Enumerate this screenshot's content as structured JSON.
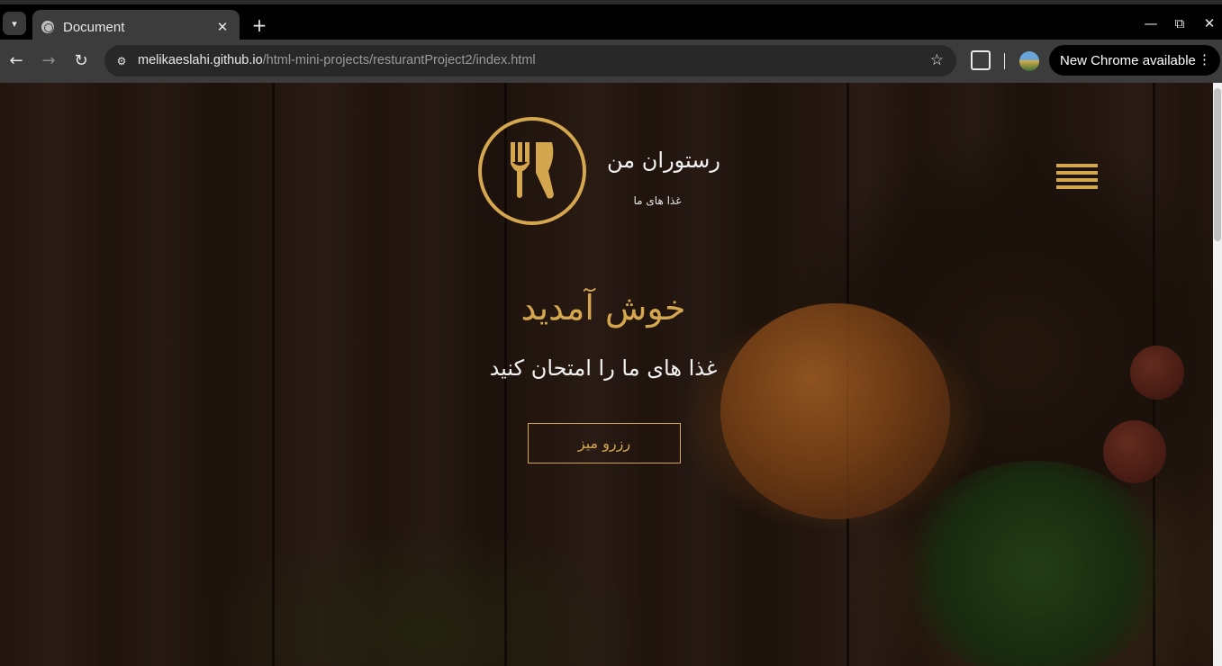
{
  "browser": {
    "tab_title": "Document",
    "tab_close": "✕",
    "new_tab": "+",
    "url_host": "melikaeslahi.github.io",
    "url_path": "/html-mini-projects/resturantProject2/index.html",
    "update_label": "New Chrome available",
    "icons": {
      "tab_search": "chevron-down-icon",
      "back": "arrow-left-icon",
      "forward": "arrow-right-icon",
      "reload": "reload-icon",
      "site_info": "tune-icon",
      "bookmark": "star-icon",
      "extensions": "puzzle-icon",
      "minimize": "minimize-icon",
      "restore": "restore-icon",
      "close": "close-icon"
    }
  },
  "site": {
    "brand_name": "رستوران من",
    "brand_tagline": "غذا های ما",
    "hero_title": "خوش آمدید",
    "hero_subtitle": "غذا های ما را امتحان کنید",
    "reserve_button": "رزرو میز",
    "accent_color": "#d4a74f"
  }
}
